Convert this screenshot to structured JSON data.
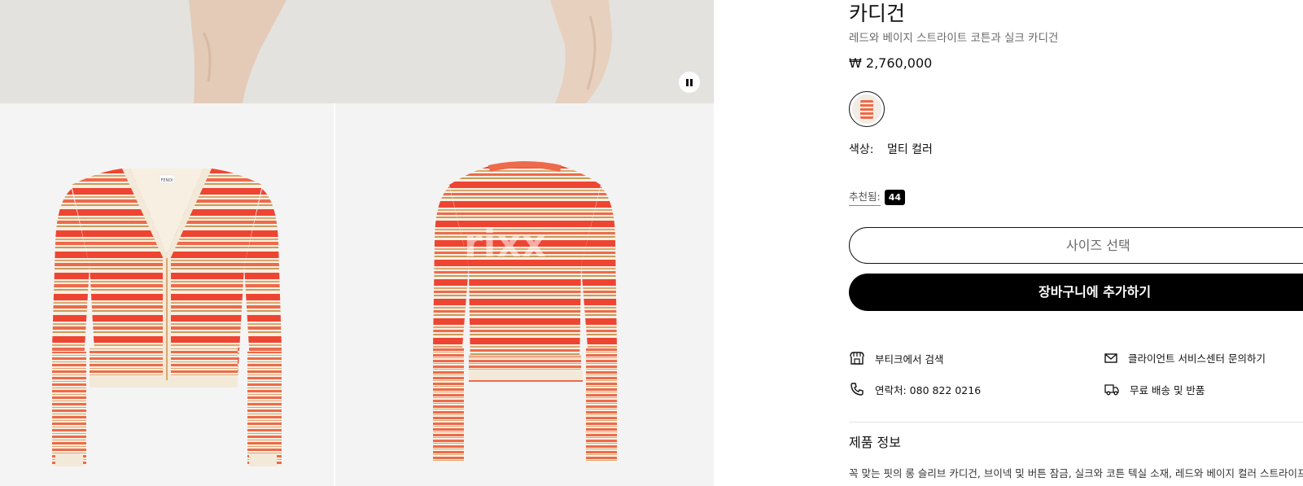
{
  "product": {
    "title": "카디건",
    "subtitle": "레드와 베이지 스트라이트 코튼과 실크 카디건",
    "price": "₩ 2,760,000",
    "color_label": "색상:",
    "color_value": "멀티 컬러",
    "recommended_label": "추천됨:",
    "recommended_count": "44",
    "size_button": "사이즈 선택",
    "cart_button": "장바구니에 추가하기"
  },
  "services": {
    "boutique": "부티크에서 검색",
    "client_service": "클라이언트 서비스센터 문의하기",
    "contact": "연락처: 080 822 0216",
    "shipping": "무료 배송 및 반품"
  },
  "product_info": {
    "title": "제품 정보",
    "description": "꼭 맞는 핏의 롱 슬리브 카디건, 브이넥 및 버튼 잠금, 실크와 코튼 텍실 소재, 레드와 베이지 컬러 스트라이프"
  },
  "gallery": {
    "watermark": "rixx",
    "front_label": "FENDI"
  },
  "colors": {
    "red": "#ee4532",
    "cream": "#f7efe2",
    "tan": "#d9a770",
    "gold": "#c89b5d"
  }
}
